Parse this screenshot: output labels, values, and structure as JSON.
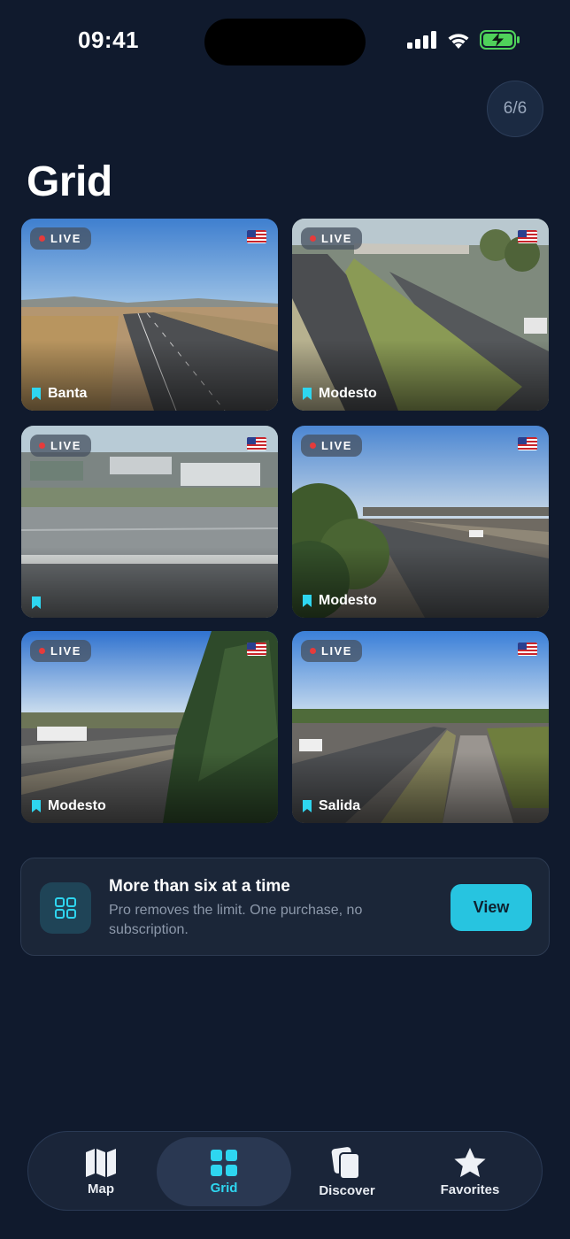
{
  "status_bar": {
    "time": "09:41"
  },
  "counter": "6/6",
  "page_title": "Grid",
  "live_label": "LIVE",
  "cameras": [
    {
      "name": "Banta",
      "live": true
    },
    {
      "name": "Modesto",
      "live": true
    },
    {
      "name": "",
      "live": true
    },
    {
      "name": "Modesto",
      "live": true
    },
    {
      "name": "Modesto",
      "live": true
    },
    {
      "name": "Salida",
      "live": true
    }
  ],
  "promo": {
    "title": "More than six at a time",
    "description": "Pro removes the limit. One purchase, no subscription.",
    "button_label": "View",
    "icon": "grid-icon"
  },
  "tabs": [
    {
      "label": "Map",
      "icon": "map-icon",
      "active": false
    },
    {
      "label": "Grid",
      "icon": "grid-icon",
      "active": true
    },
    {
      "label": "Discover",
      "icon": "cards-icon",
      "active": false
    },
    {
      "label": "Favorites",
      "icon": "star-icon",
      "active": false
    }
  ],
  "colors": {
    "accent": "#2ed6f0",
    "background": "#101a2d",
    "live_dot": "#e63b3b"
  }
}
